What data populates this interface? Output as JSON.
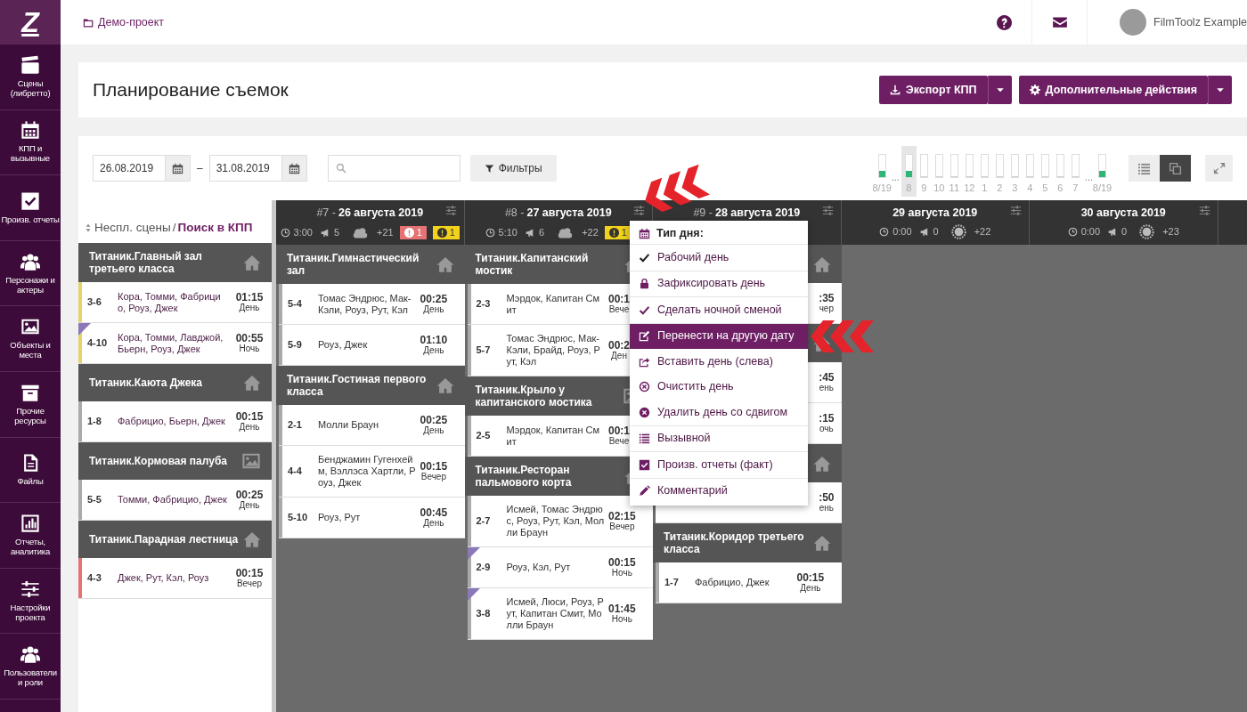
{
  "logo": "Z",
  "sidebar": [
    {
      "label": "Сцены (либретто)",
      "kind": "clapper"
    },
    {
      "label": "КПП и вызывные",
      "kind": "calendar"
    },
    {
      "label": "Произв. отчеты",
      "kind": "checkbox"
    },
    {
      "label": "Персонажи и актеры",
      "kind": "users"
    },
    {
      "label": "Объекты и места",
      "kind": "image"
    },
    {
      "label": "Прочие ресурсы",
      "kind": "archive"
    },
    {
      "label": "Файлы",
      "kind": "file"
    },
    {
      "label": "Отчеты, аналитика",
      "kind": "chart"
    },
    {
      "label": "Настройки проекта",
      "kind": "sliders"
    },
    {
      "label": "Пользователи и роли",
      "kind": "users"
    }
  ],
  "breadcrumb": "Демо-проект",
  "user": "FilmToolz Example",
  "title": "Планирование съемок",
  "actions": [
    "Экспорт КПП",
    "Дополнительные действия"
  ],
  "date_from": "26.08.2019",
  "date_separator": "–",
  "date_to": "31.08.2019",
  "filters": "Фильтры",
  "hours": [
    {
      "kind": "bar",
      "label": "8/19",
      "level": 0.25,
      "selected": false
    },
    {
      "kind": "gap",
      "label": "..."
    },
    {
      "kind": "bar",
      "label": "8",
      "level": 0.25,
      "selected": true
    },
    {
      "kind": "bar",
      "label": "9",
      "level": 0,
      "selected": false
    },
    {
      "kind": "bar",
      "label": "10",
      "level": 0,
      "selected": false
    },
    {
      "kind": "bar",
      "label": "11",
      "level": 0,
      "selected": false
    },
    {
      "kind": "bar",
      "label": "12",
      "level": 0,
      "selected": false
    },
    {
      "kind": "bar",
      "label": "1",
      "level": 0,
      "selected": false
    },
    {
      "kind": "bar",
      "label": "2",
      "level": 0,
      "selected": false
    },
    {
      "kind": "bar",
      "label": "3",
      "level": 0,
      "selected": false
    },
    {
      "kind": "bar",
      "label": "4",
      "level": 0,
      "selected": false
    },
    {
      "kind": "bar",
      "label": "5",
      "level": 0,
      "selected": false
    },
    {
      "kind": "bar",
      "label": "6",
      "level": 0,
      "selected": false
    },
    {
      "kind": "bar",
      "label": "7",
      "level": 0,
      "selected": false
    },
    {
      "kind": "gap",
      "label": "..."
    },
    {
      "kind": "bar",
      "label": "8/19",
      "level": 0.25,
      "selected": false
    }
  ],
  "views": [
    {
      "selected": false
    },
    {
      "selected": true
    }
  ],
  "unplanned": {
    "label": "Неспл. сцены",
    "separator": "/",
    "link": "Поиск в КПП",
    "groups": [
      {
        "name": "Титаник.Главный зал третьего класса",
        "kind": "home",
        "scenes": [
          {
            "id": "3-6",
            "cast": "Кора, Томми, Фабрицио, Роуз, Джек",
            "time": "01:15",
            "part": "День",
            "color": "#e6d36a",
            "marked": false
          },
          {
            "id": "4-10",
            "cast": "Кора, Томми, Лавджой, Бьерн, Роуз, Джек",
            "time": "00:55",
            "part": "Ночь",
            "color": "#e6d36a",
            "marked": true
          }
        ]
      },
      {
        "name": "Титаник.Каюта Джека",
        "kind": "home",
        "scenes": [
          {
            "id": "1-8",
            "cast": "Фабрицио, Бьерн, Джек",
            "time": "00:15",
            "part": "День",
            "color": "#aaaaaa",
            "marked": false
          }
        ]
      },
      {
        "name": "Титаник.Кормовая палуба",
        "kind": "image",
        "scenes": [
          {
            "id": "5-5",
            "cast": "Томми, Фабрицио, Джек",
            "time": "00:25",
            "part": "День",
            "color": "#aaaaaa",
            "marked": false
          }
        ]
      },
      {
        "name": "Титаник.Парадная лестница",
        "kind": "home",
        "scenes": [
          {
            "id": "4-3",
            "cast": "Джек, Рут, Кэл, Роуз",
            "time": "00:15",
            "part": "Вечер",
            "color": "#e57373",
            "marked": false
          }
        ]
      }
    ]
  },
  "days": [
    {
      "num": "#7 -",
      "date": "26 августа 2019",
      "time": "3:00",
      "calls": "5",
      "weather": {
        "kind": "cloud"
      },
      "temp": "+21",
      "badges": [
        {
          "kind": "danger",
          "text": "1"
        },
        {
          "kind": "warning",
          "text": "1"
        }
      ],
      "groups": [
        {
          "name": "Титаник.Гимнастический зал",
          "kind": "home",
          "scenes": [
            {
              "id": "5-4",
              "cast": "Томас Эндрюс, Мак-Кэли, Роуз, Рут, Кэл",
              "time": "00:25",
              "part": "День",
              "color": "#aaaaaa",
              "marked": false
            },
            {
              "id": "5-9",
              "cast": "Роуз, Джек",
              "time": "01:10",
              "part": "День",
              "color": "#aaaaaa",
              "marked": false
            }
          ]
        },
        {
          "name": "Титаник.Гостиная первого класса",
          "kind": "home",
          "scenes": [
            {
              "id": "2-1",
              "cast": "Молли Браун",
              "time": "00:25",
              "part": "День",
              "color": "#aaaaaa",
              "marked": false
            },
            {
              "id": "4-4",
              "cast": "Бенджамин Гугенхейм, Вэллэса Хартли, Роуз, Джек",
              "time": "00:15",
              "part": "Вечер",
              "color": "#aaaaaa",
              "marked": false
            },
            {
              "id": "5-10",
              "cast": "Роуз, Рут",
              "time": "00:45",
              "part": "День",
              "color": "#aaaaaa",
              "marked": false
            }
          ]
        }
      ]
    },
    {
      "num": "#8 -",
      "date": "27 августа 2019",
      "time": "5:10",
      "calls": "6",
      "weather": {
        "kind": "cloud"
      },
      "temp": "+22",
      "badges": [
        {
          "kind": "warning",
          "text": "1"
        }
      ],
      "groups": [
        {
          "name": "Титаник.Капитанский мостик",
          "kind": "home",
          "scenes": [
            {
              "id": "2-3",
              "cast": "Мэрдок, Капитан Смит",
              "time": "00:1",
              "part": "Вече",
              "color": "#aaaaaa",
              "marked": false
            },
            {
              "id": "5-7",
              "cast": "Томас Эндрюс, Мак-Кэли, Брайд, Роуз, Рут, Кэл",
              "time": "00:2",
              "part": "Ден",
              "color": "#aaaaaa",
              "marked": false
            }
          ]
        },
        {
          "name": "Титаник.Крыло у капитанского мостика",
          "kind": "image",
          "scenes": [
            {
              "id": "2-5",
              "cast": "Мэрдок, Капитан Смит",
              "time": "00:1",
              "part": "Вече",
              "color": "#aaaaaa",
              "marked": false
            }
          ]
        },
        {
          "name": "Титаник.Ресторан пальмового корта",
          "kind": "home",
          "scenes": [
            {
              "id": "2-7",
              "cast": "Исмей, Томас Эндрюс, Роуз, Рут, Кэл, Молли Браун",
              "time": "02:15",
              "part": "Вечер",
              "color": "#aaaaaa",
              "marked": false
            },
            {
              "id": "2-9",
              "cast": "Роуз, Кэл, Рут",
              "time": "00:15",
              "part": "Ночь",
              "color": "#aaaaaa",
              "marked": true
            },
            {
              "id": "3-8",
              "cast": "Исмей, Люси, Роуз, Рут, Капитан Смит, Молли Браун",
              "time": "01:45",
              "part": "Ночь",
              "color": "#aaaaaa",
              "marked": true
            }
          ]
        }
      ]
    },
    {
      "num": "#9 -",
      "date": "28 августа 2019",
      "groups": [
        {
          "kind": "home",
          "scenes": [
            {
              "time": ":35",
              "part": "чер"
            }
          ]
        },
        {
          "kind": "home",
          "scenes": [
            {
              "time": ":45",
              "part": "ень"
            },
            {
              "time": ":15",
              "part": "очь"
            }
          ]
        },
        {
          "kind": "home",
          "scenes": [
            {
              "time": ":50",
              "part": "ень"
            }
          ]
        },
        {
          "name": "Титаник.Коридор третьего класса",
          "kind": "home",
          "scenes": [
            {
              "id": "1-7",
              "cast": "Фабрицио, Джек",
              "time": "00:15",
              "part": "День",
              "color": "#aaaaaa",
              "marked": false
            }
          ]
        }
      ]
    },
    {
      "date": "29 августа 2019",
      "time": "0:00",
      "calls": "0",
      "weather": {
        "kind": "sun"
      },
      "temp": "+22"
    },
    {
      "date": "30 августа 2019",
      "time": "0:00",
      "calls": "0",
      "weather": {
        "kind": "sun"
      },
      "temp": "+23"
    }
  ],
  "menu": {
    "title": "Тип дня:",
    "sections": [
      [
        {
          "label": "Рабочий день",
          "kind": "check",
          "selected": false
        }
      ],
      [
        {
          "label": "Зафиксировать день",
          "kind": "lock",
          "selected": false
        }
      ],
      [
        {
          "label": "Сделать ночной сменой",
          "kind": "check",
          "selected": false
        }
      ],
      [
        {
          "label": "Перенести на другую дату",
          "kind": "edit",
          "selected": true
        },
        {
          "label": "Вставить день (слева)",
          "kind": "share",
          "selected": false
        },
        {
          "label": "Очистить день",
          "kind": "xcircle",
          "selected": false
        },
        {
          "label": "Удалить день со сдвигом",
          "kind": "xfilled",
          "selected": false
        }
      ],
      [
        {
          "label": "Вызывной",
          "kind": "list",
          "selected": false
        }
      ],
      [
        {
          "label": "Произв. отчеты (факт)",
          "kind": "checkbox",
          "selected": false
        }
      ],
      [
        {
          "label": "Комментарий",
          "kind": "pencil",
          "selected": false
        }
      ]
    ]
  }
}
